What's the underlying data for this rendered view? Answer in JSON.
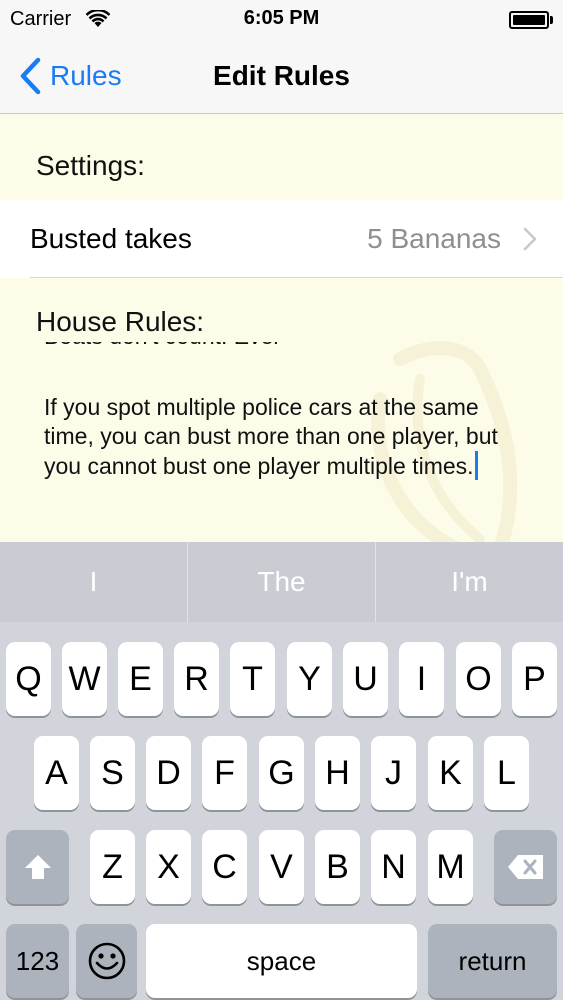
{
  "status": {
    "carrier": "Carrier",
    "time": "6:05 PM"
  },
  "nav": {
    "back_label": "Rules",
    "title": "Edit Rules"
  },
  "settings": {
    "header": "Settings:",
    "busted_row": {
      "label": "Busted takes",
      "value": "5 Bananas"
    }
  },
  "house_rules": {
    "header": "House Rules:",
    "clipped_line": "Boats don't count! Evel",
    "text": "If you spot multiple police cars at the same time, you can bust more than one player, but you cannot bust one player multiple times."
  },
  "predictions": [
    "I",
    "The",
    "I'm"
  ],
  "keyboard": {
    "row1": [
      "Q",
      "W",
      "E",
      "R",
      "T",
      "Y",
      "U",
      "I",
      "O",
      "P"
    ],
    "row2": [
      "A",
      "S",
      "D",
      "F",
      "G",
      "H",
      "J",
      "K",
      "L"
    ],
    "row3": [
      "Z",
      "X",
      "C",
      "V",
      "B",
      "N",
      "M"
    ],
    "numbers_label": "123",
    "space_label": "space",
    "return_label": "return"
  },
  "colors": {
    "accent": "#1a7cf5",
    "content_bg": "#fdfce9"
  }
}
